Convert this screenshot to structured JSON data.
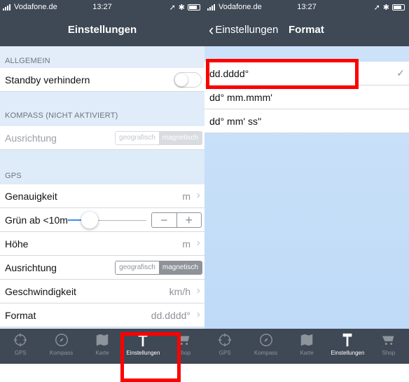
{
  "status": {
    "carrier": "Vodafone.de",
    "time": "13:27"
  },
  "left": {
    "title": "Einstellungen",
    "sections": {
      "allgemein": "ALLGEMEIN",
      "kompass": "KOMPASS (NICHT AKTIVIERT)",
      "gps": "GPS"
    },
    "rows": {
      "standby": "Standby verhindern",
      "ausrichtung1": "Ausrichtung",
      "genauigkeit": "Genauigkeit",
      "genauigkeit_value": "m",
      "gruen": "Grün ab <10m",
      "hoehe": "Höhe",
      "hoehe_value": "m",
      "ausrichtung2": "Ausrichtung",
      "geschwindigkeit": "Geschwindigkeit",
      "geschwindigkeit_value": "km/h",
      "format": "Format",
      "format_value": "dd.dddd°"
    },
    "segment": {
      "geo": "geografisch",
      "mag": "magnetisch"
    },
    "stepper": {
      "minus": "−",
      "plus": "+"
    },
    "toggle_on": false,
    "slider_fraction": 0.18
  },
  "right": {
    "back_label": "Einstellungen",
    "title": "Format",
    "options": [
      "dd.dddd°",
      "dd° mm.mmm'",
      "dd° mm' ss''"
    ],
    "selected_index": 0
  },
  "tabs": [
    {
      "label": "GPS",
      "icon": "crosshair-icon"
    },
    {
      "label": "Kompass",
      "icon": "compass-icon"
    },
    {
      "label": "Karte",
      "icon": "map-icon"
    },
    {
      "label": "Einstellungen",
      "icon": "hammer-icon",
      "active": true
    },
    {
      "label": "Shop",
      "icon": "cart-icon"
    }
  ],
  "colors": {
    "bar": "#3f4855",
    "highlight": "#ff0000",
    "accent": "#3d8ff0"
  }
}
